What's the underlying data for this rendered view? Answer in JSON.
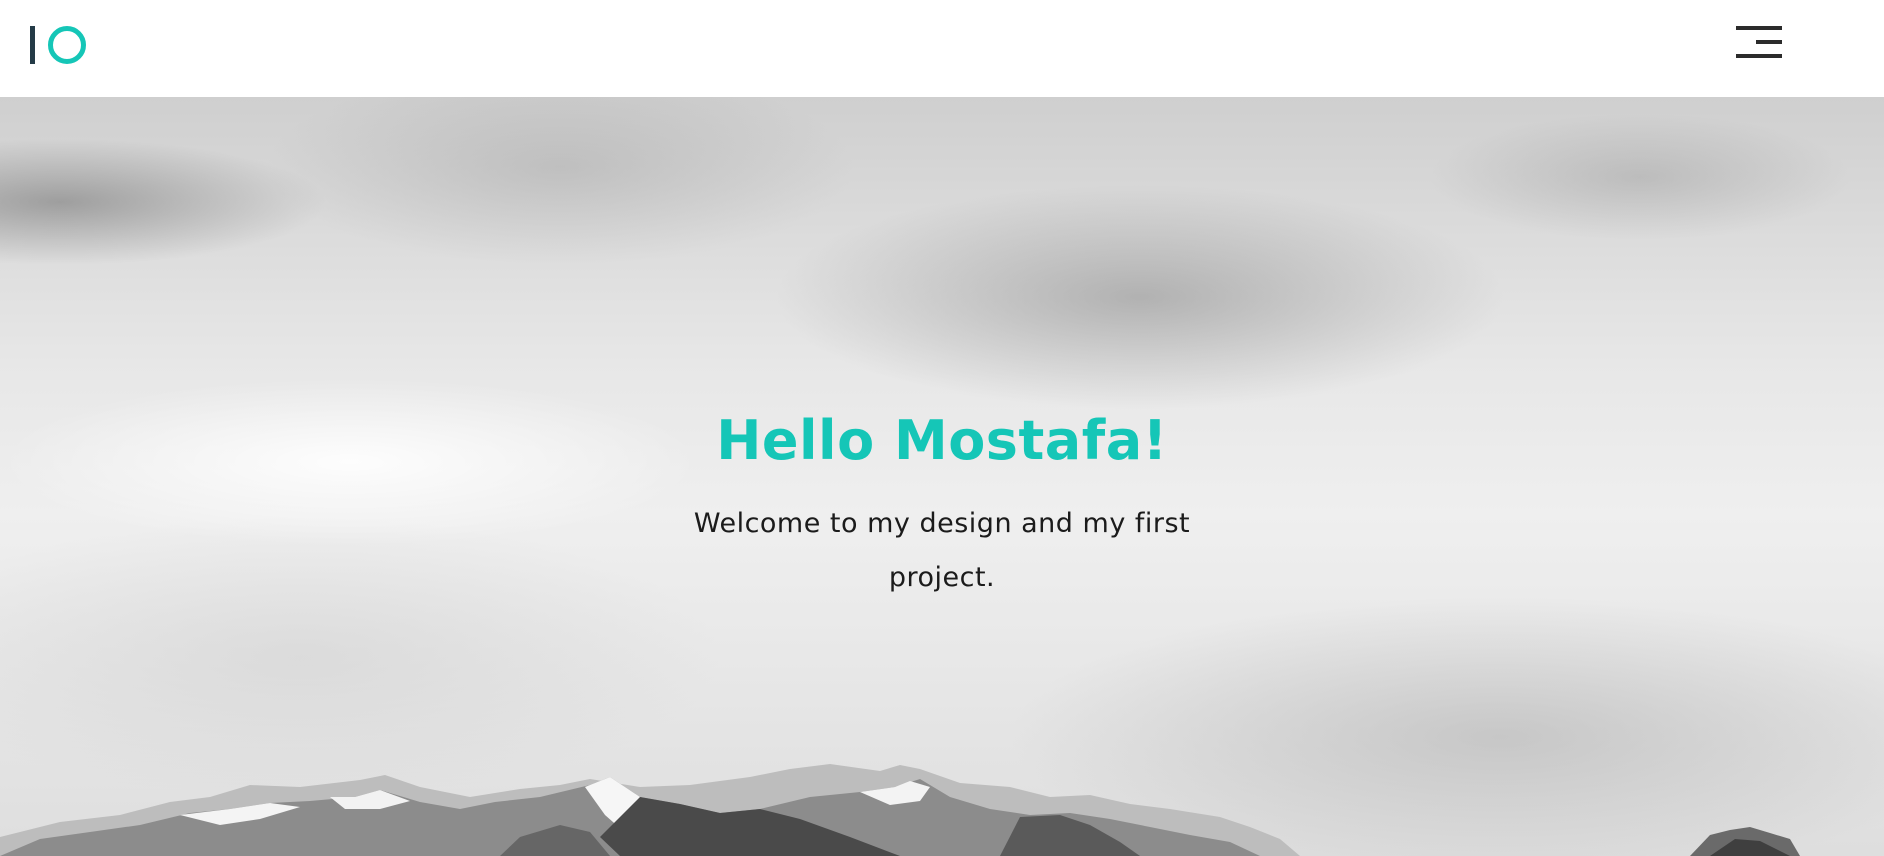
{
  "navbar": {
    "logo_icon": "logo-io-mark",
    "menu_icon": "hamburger-menu-icon"
  },
  "hero": {
    "title": "Hello Mostafa!",
    "text": "Welcome to my design and my first project."
  },
  "colors": {
    "accent": "#15c6b7",
    "logo_bar": "#243b47",
    "menu": "#2b2b2b",
    "text": "#1b1b1b",
    "navbar_bg": "#ffffff"
  }
}
